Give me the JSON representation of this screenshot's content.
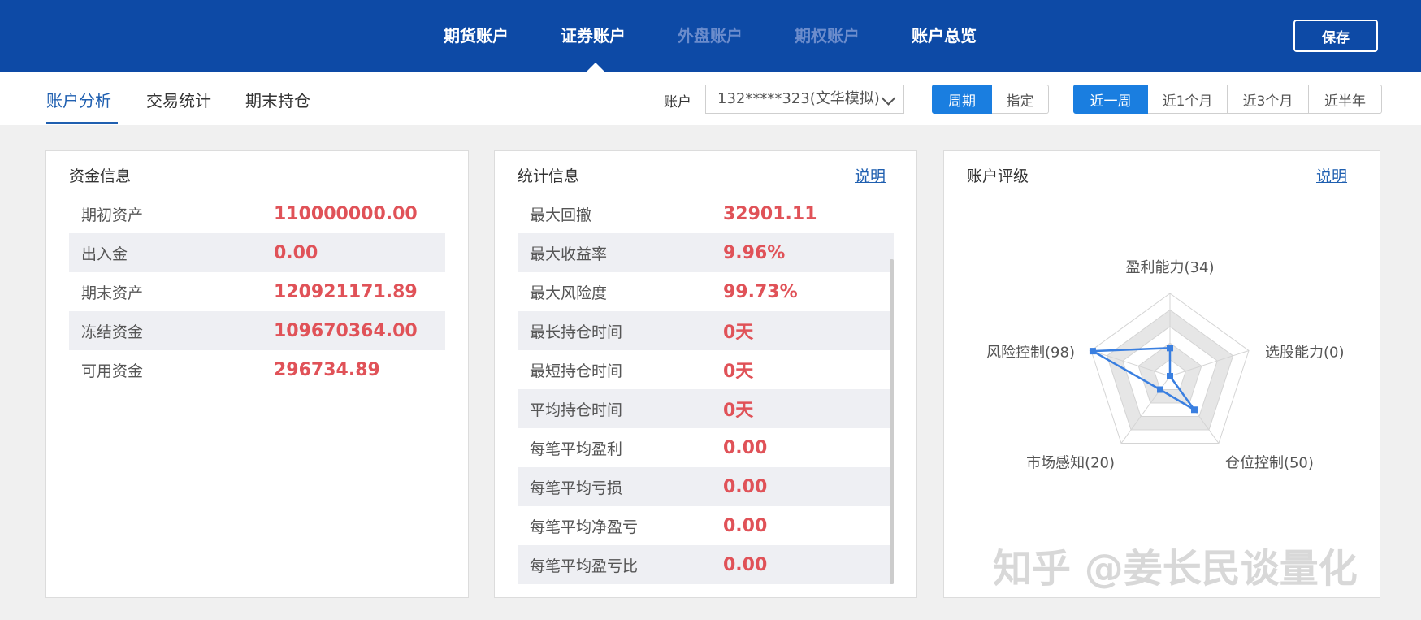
{
  "top_nav": {
    "tabs": [
      {
        "label": "期货账户",
        "state": "normal"
      },
      {
        "label": "证券账户",
        "state": "active"
      },
      {
        "label": "外盘账户",
        "state": "disabled"
      },
      {
        "label": "期权账户",
        "state": "disabled"
      },
      {
        "label": "账户总览",
        "state": "normal"
      }
    ],
    "save_label": "保存"
  },
  "sub_nav": {
    "tabs": [
      {
        "label": "账户分析",
        "active": true
      },
      {
        "label": "交易统计",
        "active": false
      },
      {
        "label": "期末持仓",
        "active": false
      }
    ],
    "account_label": "账户",
    "account_value": "132*****323(文华模拟)",
    "mode_options": [
      {
        "label": "周期",
        "selected": true
      },
      {
        "label": "指定",
        "selected": false
      }
    ],
    "range_options": [
      {
        "label": "近一周",
        "selected": true
      },
      {
        "label": "近1个月",
        "selected": false
      },
      {
        "label": "近3个月",
        "selected": false
      },
      {
        "label": "近半年",
        "selected": false
      }
    ]
  },
  "funds_panel": {
    "title": "资金信息",
    "rows": [
      {
        "label": "期初资产",
        "value": "110000000.00"
      },
      {
        "label": "出入金",
        "value": "0.00"
      },
      {
        "label": "期末资产",
        "value": "120921171.89"
      },
      {
        "label": "冻结资金",
        "value": "109670364.00"
      },
      {
        "label": "可用资金",
        "value": "296734.89"
      }
    ]
  },
  "stats_panel": {
    "title": "统计信息",
    "link": "说明",
    "rows": [
      {
        "label": "最大回撤",
        "value": "32901.11"
      },
      {
        "label": "最大收益率",
        "value": "9.96%"
      },
      {
        "label": "最大风险度",
        "value": "99.73%"
      },
      {
        "label": "最长持仓时间",
        "value": "0天"
      },
      {
        "label": "最短持仓时间",
        "value": "0天"
      },
      {
        "label": "平均持仓时间",
        "value": "0天"
      },
      {
        "label": "每笔平均盈利",
        "value": "0.00"
      },
      {
        "label": "每笔平均亏损",
        "value": "0.00"
      },
      {
        "label": "每笔平均净盈亏",
        "value": "0.00"
      },
      {
        "label": "每笔平均盈亏比",
        "value": "0.00"
      }
    ]
  },
  "rating_panel": {
    "title": "账户评级",
    "link": "说明",
    "line_color": "#3a7fe0"
  },
  "chart_data": {
    "type": "radar",
    "title": "",
    "range": [
      0,
      100
    ],
    "axes": [
      {
        "name": "盈利能力",
        "value": 34,
        "label": "盈利能力(34)"
      },
      {
        "name": "选股能力",
        "value": 0,
        "label": "选股能力(0)"
      },
      {
        "name": "仓位控制",
        "value": 50,
        "label": "仓位控制(50)"
      },
      {
        "name": "市场感知",
        "value": 20,
        "label": "市场感知(20)"
      },
      {
        "name": "风险控制",
        "value": 98,
        "label": "风险控制(98)"
      }
    ],
    "grid_levels": 5
  },
  "watermark": "知乎 @姜长民谈量化"
}
